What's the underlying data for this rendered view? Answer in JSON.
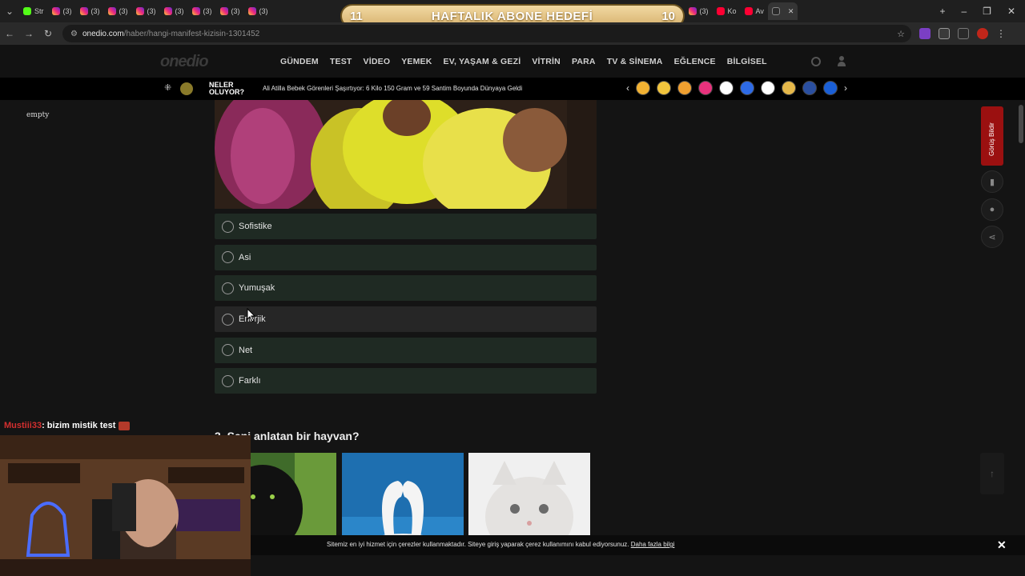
{
  "browser": {
    "tabs": [
      {
        "icon": "kick",
        "label": "Str"
      },
      {
        "icon": "instagram",
        "label": "(3)"
      },
      {
        "icon": "instagram",
        "label": "(3)"
      },
      {
        "icon": "instagram",
        "label": "(3)"
      },
      {
        "icon": "instagram",
        "label": "(3)"
      },
      {
        "icon": "instagram",
        "label": "(3)"
      },
      {
        "icon": "instagram",
        "label": "(3)"
      },
      {
        "icon": "instagram",
        "label": "(3)"
      },
      {
        "icon": "instagram",
        "label": "(3)"
      },
      {
        "icon": "instagram",
        "label": "(3)"
      },
      {
        "icon": "instagram",
        "label": "(3)"
      },
      {
        "icon": "instagram",
        "label": "(3)"
      },
      {
        "icon": "youtube",
        "label": "Ko"
      },
      {
        "icon": "youtube",
        "label": "Av"
      },
      {
        "icon": "onedio",
        "label": ""
      }
    ],
    "url_host": "onedio.com",
    "url_path": "/haber/hangi-manifest-kizisin-1301452"
  },
  "goal_banner": {
    "left_count": "11",
    "title": "HAFTALIK ABONE HEDEFİ",
    "right_count": "10"
  },
  "site": {
    "logo": "onedio",
    "nav": [
      "GÜNDEM",
      "TEST",
      "VİDEO",
      "YEMEK",
      "EV, YAŞAM & GEZİ",
      "VİTRİN",
      "PARA",
      "TV & SİNEMA",
      "EĞLENCE",
      "BİLGİSEL"
    ],
    "ticker_label_1": "NELER",
    "ticker_label_2": "OLUYOR?",
    "ticker_headline": "Ali Atilla Bebek Görenleri Şaşırtıyor: 6 Kilo 150 Gram ve 59 Santim Boyunda Dünyaya Geldi",
    "emoji_colors": [
      "#f2b233",
      "#f2c53d",
      "#f0a030",
      "#e8327d",
      "#ffffff",
      "#2e6be6",
      "#ffffff",
      "#e5b84a",
      "#2a4fa0",
      "#1a5fd6"
    ]
  },
  "left_label": "empty",
  "quiz": {
    "options": [
      "Sofistike",
      "Asi",
      "Yumuşak",
      "Enerjik",
      "Net",
      "Farklı"
    ],
    "question3_title": "3. Seni anlatan bir hayvan?",
    "animals": [
      "black-panther",
      "swans",
      "white-cat"
    ]
  },
  "side_tools": {
    "feedback_label": "Görüş Bildir"
  },
  "cookie": {
    "text": "Sitemiz en iyi hizmet için çerezler kullanmaktadır. Siteye giriş yaparak çerez kullanımını kabul ediyorsunuz.",
    "link": "Daha fazla bilgi"
  },
  "stream": {
    "chat_user": "Mustiii33",
    "chat_message": ": bizim mistik test"
  }
}
